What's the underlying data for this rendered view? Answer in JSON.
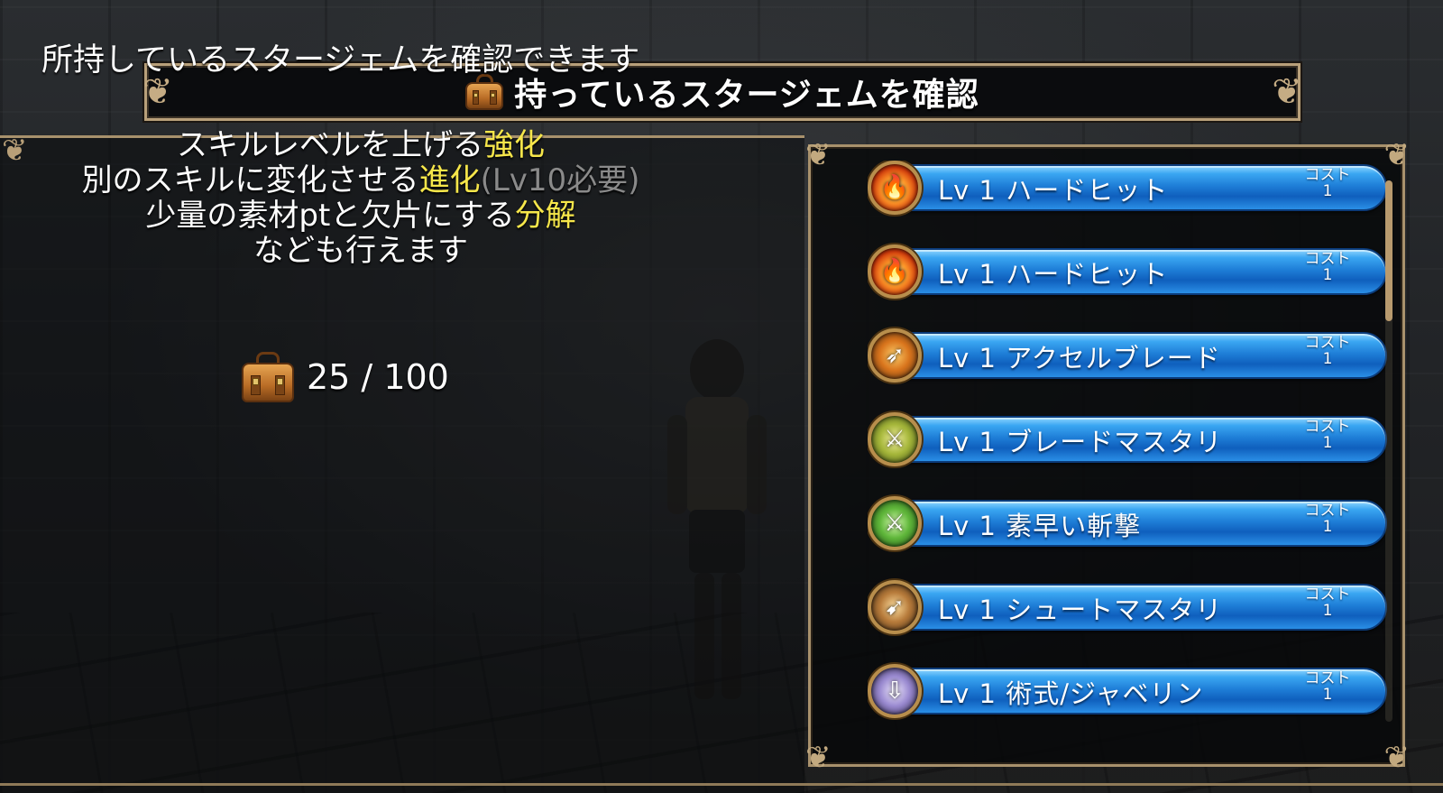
{
  "header": {
    "title": "持っているスタージェムを確認",
    "icon": "bag-icon"
  },
  "left": {
    "intro": "所持しているスタージェムを確認できます",
    "lines": [
      {
        "pre": "スキルレベルを上げる",
        "hl": "強化",
        "post": ""
      },
      {
        "pre": "別のスキルに変化させる",
        "hl": "進化",
        "post": "(Lv10必要)"
      },
      {
        "pre": "少量の素材ptと欠片にする",
        "hl": "分解",
        "post": ""
      },
      {
        "pre": "なども行えます",
        "hl": "",
        "post": ""
      }
    ],
    "count": "25 / 100"
  },
  "gems": [
    {
      "level": "Lv 1",
      "name": "ハードヒット",
      "cost_label": "コスト",
      "cost": "1",
      "icon": "fire-icon",
      "icon_class": "icon-fire",
      "glyph": "🔥"
    },
    {
      "level": "Lv 1",
      "name": "ハードヒット",
      "cost_label": "コスト",
      "cost": "1",
      "icon": "fire-icon",
      "icon_class": "icon-fire",
      "glyph": "🔥"
    },
    {
      "level": "Lv 1",
      "name": "アクセルブレード",
      "cost_label": "コスト",
      "cost": "1",
      "icon": "dash-blade-icon",
      "icon_class": "icon-accel",
      "glyph": "➶"
    },
    {
      "level": "Lv 1",
      "name": "ブレードマスタリ",
      "cost_label": "コスト",
      "cost": "1",
      "icon": "sword-icon",
      "icon_class": "icon-blade",
      "glyph": "⚔"
    },
    {
      "level": "Lv 1",
      "name": "素早い斬撃",
      "cost_label": "コスト",
      "cost": "1",
      "icon": "swift-slash-icon",
      "icon_class": "icon-speed",
      "glyph": "⚔"
    },
    {
      "level": "Lv 1",
      "name": "シュートマスタリ",
      "cost_label": "コスト",
      "cost": "1",
      "icon": "bow-icon",
      "icon_class": "icon-shoot",
      "glyph": "➹"
    },
    {
      "level": "Lv 1",
      "name": "術式/ジャベリン",
      "cost_label": "コスト",
      "cost": "1",
      "icon": "javelin-icon",
      "icon_class": "icon-spell",
      "glyph": "⇩"
    }
  ],
  "scroll": {
    "position": 0.0,
    "visible_fraction": 0.26
  }
}
